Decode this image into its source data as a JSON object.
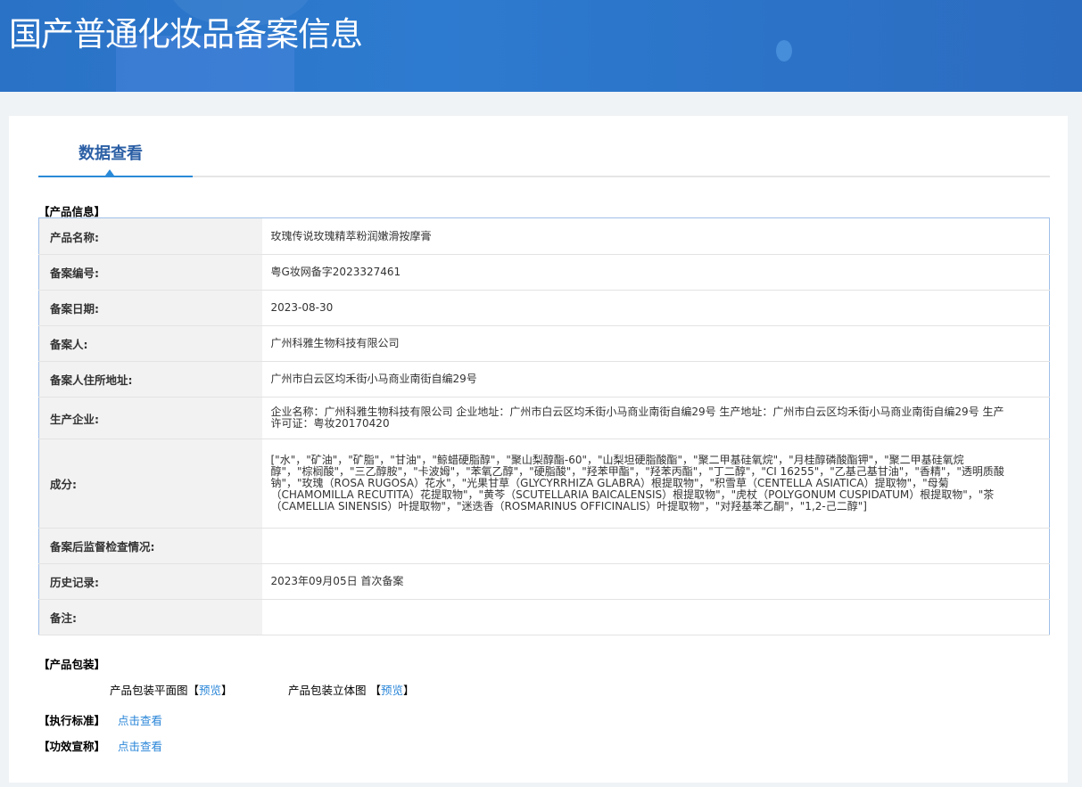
{
  "header": {
    "title": "国产普通化妆品备案信息"
  },
  "tab": {
    "label": "数据查看"
  },
  "product_info": {
    "section_title": "【产品信息】",
    "rows": [
      {
        "label": "产品名称:",
        "value": "玫瑰传说玫瑰精萃粉润嫩滑按摩膏"
      },
      {
        "label": "备案编号:",
        "value": "粤G妆网备字2023327461"
      },
      {
        "label": "备案日期:",
        "value": "2023-08-30"
      },
      {
        "label": "备案人:",
        "value": "广州科雅生物科技有限公司"
      },
      {
        "label": "备案人住所地址:",
        "value": "广州市白云区均禾街小马商业南街自编29号"
      },
      {
        "label": "生产企业:",
        "value": "企业名称：广州科雅生物科技有限公司 企业地址：广州市白云区均禾街小马商业南街自编29号 生产地址：广州市白云区均禾街小马商业南街自编29号 生产许可证：粤妆20170420"
      },
      {
        "label": "成分:",
        "value": "[\"水\"，\"矿油\"，\"矿脂\"，\"甘油\"，\"鲸蜡硬脂醇\"，\"聚山梨醇酯-60\"，\"山梨坦硬脂酸酯\"，\"聚二甲基硅氧烷\"，\"月桂醇磷酸酯钾\"，\"聚二甲基硅氧烷醇\"，\"棕榈酸\"，\"三乙醇胺\"，\"卡波姆\"，\"苯氧乙醇\"，\"硬脂酸\"，\"羟苯甲酯\"，\"羟苯丙酯\"，\"丁二醇\"，\"CI 16255\"，\"乙基己基甘油\"，\"香精\"，\"透明质酸钠\"，\"玫瑰（ROSA RUGOSA）花水\"，\"光果甘草（GLYCYRRHIZA GLABRA）根提取物\"，\"积雪草（CENTELLA ASIATICA）提取物\"，\"母菊（CHAMOMILLA RECUTITA）花提取物\"，\"黄芩（SCUTELLARIA BAICALENSIS）根提取物\"，\"虎杖（POLYGONUM CUSPIDATUM）根提取物\"，\"茶（CAMELLIA SINENSIS）叶提取物\"，\"迷迭香（ROSMARINUS OFFICINALIS）叶提取物\"，\"对羟基苯乙酮\"，\"1,2-己二醇\"]"
      },
      {
        "label": "备案后监督检查情况:",
        "value": ""
      },
      {
        "label": "历史记录:",
        "value": "2023年09月05日 首次备案"
      },
      {
        "label": "备注:",
        "value": ""
      }
    ]
  },
  "packaging": {
    "section_title": "【产品包装】",
    "flat_label": "产品包装平面图",
    "flat_link": "预览",
    "solid_label": "产品包装立体图 ",
    "solid_link": "预览",
    "bracket_open": "【",
    "bracket_close": "】"
  },
  "standard": {
    "section_title": "【执行标准】",
    "link": "点击查看"
  },
  "efficacy": {
    "section_title": "【功效宣称】",
    "link": "点击查看"
  }
}
